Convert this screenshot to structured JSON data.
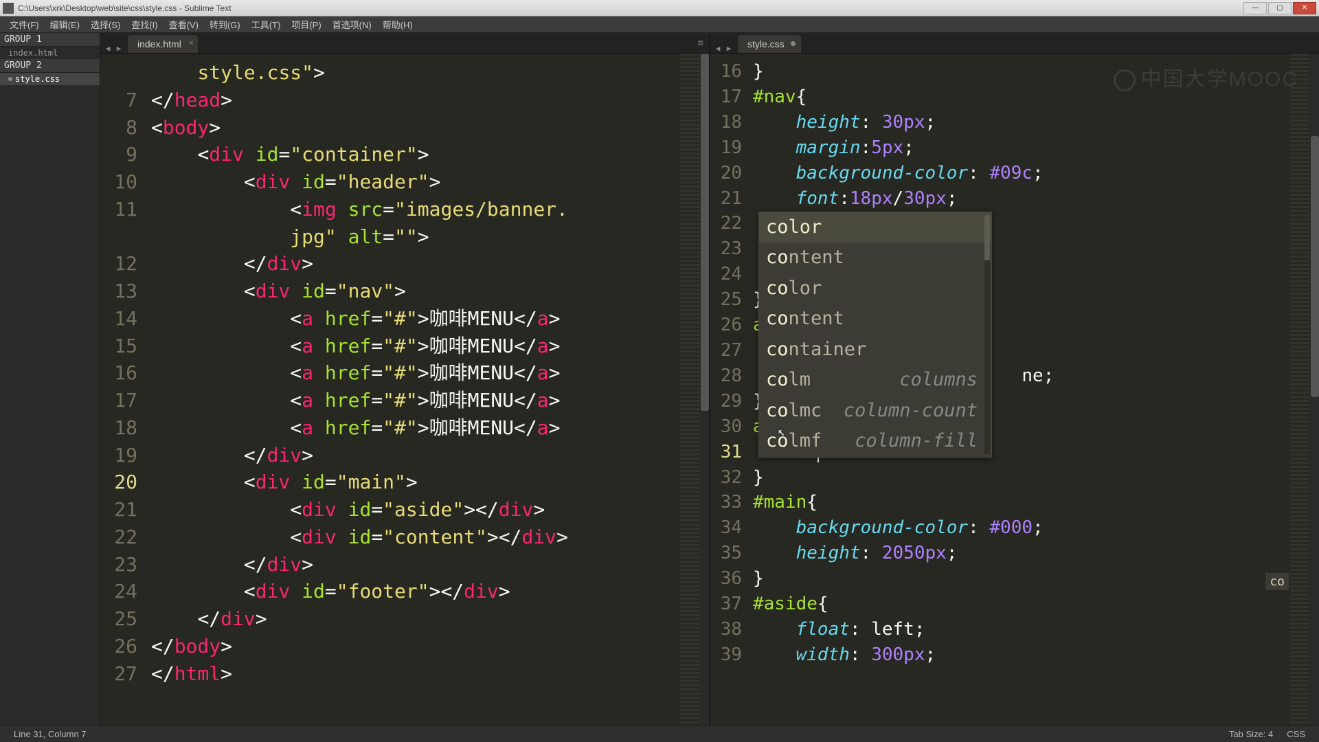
{
  "window": {
    "title": "C:\\Users\\xrk\\Desktop\\web\\site\\css\\style.css - Sublime Text"
  },
  "menus": [
    "文件(F)",
    "编辑(E)",
    "选择(S)",
    "查找(I)",
    "查看(V)",
    "转到(G)",
    "工具(T)",
    "项目(P)",
    "首选项(N)",
    "帮助(H)"
  ],
  "sidebar": {
    "group1": "GROUP 1",
    "group1_file": "index.html",
    "group2": "GROUP 2",
    "group2_file": "style.css"
  },
  "tabs": {
    "left": "index.html",
    "right": "style.css"
  },
  "left_lines": [
    {
      "n": 7,
      "html": "<span class='pun'>&lt;/</span><span class='tg'>head</span><span class='pun'>&gt;</span>",
      "indent": 0,
      "pretext": "style.css\"&gt;"
    },
    {
      "n": 8,
      "html": "<span class='pun'>&lt;</span><span class='tg'>body</span><span class='pun'>&gt;</span>"
    },
    {
      "n": 9,
      "html": "    <span class='pun'>&lt;</span><span class='tg'>div</span> <span class='an'>id</span><span class='pun'>=</span><span class='st'>\"container\"</span><span class='pun'>&gt;</span>"
    },
    {
      "n": 10,
      "html": "        <span class='pun'>&lt;</span><span class='tg'>div</span> <span class='an'>id</span><span class='pun'>=</span><span class='st'>\"header\"</span><span class='pun'>&gt;</span>"
    },
    {
      "n": 11,
      "html": "            <span class='pun'>&lt;</span><span class='tg'>img</span> <span class='an'>src</span><span class='pun'>=</span><span class='st'>\"images/banner.</span>"
    },
    {
      "n": "",
      "html": "            <span class='st'>jpg\"</span> <span class='an'>alt</span><span class='pun'>=</span><span class='st'>\"\"</span><span class='pun'>&gt;</span>"
    },
    {
      "n": 12,
      "html": "        <span class='pun'>&lt;/</span><span class='tg'>div</span><span class='pun'>&gt;</span>"
    },
    {
      "n": 13,
      "html": "        <span class='pun'>&lt;</span><span class='tg'>div</span> <span class='an'>id</span><span class='pun'>=</span><span class='st'>\"nav\"</span><span class='pun'>&gt;</span>"
    },
    {
      "n": 14,
      "html": "            <span class='pun'>&lt;</span><span class='tg'>a</span> <span class='an'>href</span><span class='pun'>=</span><span class='st'>\"#\"</span><span class='pun'>&gt;</span><span class='txt'>咖啡MENU</span><span class='pun'>&lt;/</span><span class='tg'>a</span><span class='pun'>&gt;</span>"
    },
    {
      "n": 15,
      "html": "            <span class='pun'>&lt;</span><span class='tg'>a</span> <span class='an'>href</span><span class='pun'>=</span><span class='st'>\"#\"</span><span class='pun'>&gt;</span><span class='txt'>咖啡MENU</span><span class='pun'>&lt;/</span><span class='tg'>a</span><span class='pun'>&gt;</span>"
    },
    {
      "n": 16,
      "html": "            <span class='pun'>&lt;</span><span class='tg'>a</span> <span class='an'>href</span><span class='pun'>=</span><span class='st'>\"#\"</span><span class='pun'>&gt;</span><span class='txt'>咖啡MENU</span><span class='pun'>&lt;/</span><span class='tg'>a</span><span class='pun'>&gt;</span>"
    },
    {
      "n": 17,
      "html": "            <span class='pun'>&lt;</span><span class='tg'>a</span> <span class='an'>href</span><span class='pun'>=</span><span class='st'>\"#\"</span><span class='pun'>&gt;</span><span class='txt'>咖啡MENU</span><span class='pun'>&lt;/</span><span class='tg'>a</span><span class='pun'>&gt;</span>"
    },
    {
      "n": 18,
      "html": "            <span class='pun'>&lt;</span><span class='tg'>a</span> <span class='an'>href</span><span class='pun'>=</span><span class='st'>\"#\"</span><span class='pun'>&gt;</span><span class='txt'>咖啡MENU</span><span class='pun'>&lt;/</span><span class='tg'>a</span><span class='pun'>&gt;</span>"
    },
    {
      "n": 19,
      "html": "        <span class='pun'>&lt;/</span><span class='tg'>div</span><span class='pun'>&gt;</span>"
    },
    {
      "n": 20,
      "hl": true,
      "html": "        <span class='pun'>&lt;</span><span class='tg'>div</span> <span class='an'>id</span><span class='pun'>=</span><span class='st'>\"main\"</span><span class='pun'>&gt;</span>"
    },
    {
      "n": 21,
      "html": "            <span class='pun'>&lt;</span><span class='tg'>div</span> <span class='an'>id</span><span class='pun'>=</span><span class='st'>\"aside\"</span><span class='pun'>&gt;&lt;/</span><span class='tg'>div</span><span class='pun'>&gt;</span>"
    },
    {
      "n": 22,
      "html": "            <span class='pun'>&lt;</span><span class='tg'>div</span> <span class='an'>id</span><span class='pun'>=</span><span class='st'>\"content\"</span><span class='pun'>&gt;&lt;/</span><span class='tg'>div</span><span class='pun'>&gt;</span>"
    },
    {
      "n": 23,
      "html": "        <span class='pun'>&lt;/</span><span class='tg'>div</span><span class='pun'>&gt;</span>"
    },
    {
      "n": 24,
      "html": "        <span class='pun'>&lt;</span><span class='tg'>div</span> <span class='an'>id</span><span class='pun'>=</span><span class='st'>\"footer\"</span><span class='pun'>&gt;&lt;/</span><span class='tg'>div</span><span class='pun'>&gt;</span>"
    },
    {
      "n": 25,
      "html": "    <span class='pun'>&lt;/</span><span class='tg'>div</span><span class='pun'>&gt;</span>"
    },
    {
      "n": 26,
      "html": "<span class='pun'>&lt;/</span><span class='tg'>body</span><span class='pun'>&gt;</span>"
    },
    {
      "n": 27,
      "html": "<span class='pun'>&lt;/</span><span class='tg'>html</span><span class='pun'>&gt;</span>"
    }
  ],
  "right_lines": [
    {
      "n": 16,
      "html": "<span class='pun'>}</span>"
    },
    {
      "n": 17,
      "html": "<span class='sel'>#nav</span><span class='pun'>{</span>"
    },
    {
      "n": 18,
      "html": "    <span class='prop'>height</span><span class='pun'>:</span> <span class='num'>30px</span><span class='pun'>;</span>"
    },
    {
      "n": 19,
      "html": "    <span class='prop'>margin</span><span class='pun'>:</span><span class='num'>5px</span><span class='pun'>;</span>"
    },
    {
      "n": 20,
      "html": "    <span class='prop'>background-color</span><span class='pun'>:</span> <span class='num'>#09c</span><span class='pun'>;</span>"
    },
    {
      "n": 21,
      "html": "    <span class='prop'>font</span><span class='pun'>:</span><span class='num'>18px</span><span class='pun'>/</span><span class='num'>30px</span><span class='pun'>;</span>"
    },
    {
      "n": 22,
      "html": "    "
    },
    {
      "n": 23,
      "html": "                    <span class='pun'>;</span>"
    },
    {
      "n": 24,
      "html": "                   <span class='pun'>;</span>"
    },
    {
      "n": 25,
      "html": "<span class='pun'>}</span>"
    },
    {
      "n": 26,
      "html": "<span class='sel'>a</span><span class='pun'>:</span><span class='sel'>li</span>"
    },
    {
      "n": 27,
      "html": "    "
    },
    {
      "n": 28,
      "html": "                         <span class='txt'>ne</span><span class='pun'>;</span>"
    },
    {
      "n": 29,
      "html": "<span class='pun'>}</span>"
    },
    {
      "n": 30,
      "html": "<span class='sel'>a</span><span class='pun'>:</span><span class='sel'>vi</span>"
    },
    {
      "n": 31,
      "hl": true,
      "html": "    <span class='txt'>co</span><span class='cursor'></span>"
    },
    {
      "n": 32,
      "html": "<span class='pun'>}</span>"
    },
    {
      "n": 33,
      "html": "<span class='sel'>#main</span><span class='pun'>{</span>"
    },
    {
      "n": 34,
      "html": "    <span class='prop'>background-color</span><span class='pun'>:</span> <span class='num'>#000</span><span class='pun'>;</span>"
    },
    {
      "n": 35,
      "html": "    <span class='prop'>height</span><span class='pun'>:</span> <span class='num'>2050px</span><span class='pun'>;</span>"
    },
    {
      "n": 36,
      "html": "<span class='pun'>}</span>"
    },
    {
      "n": 37,
      "html": "<span class='sel'>#aside</span><span class='pun'>{</span>"
    },
    {
      "n": 38,
      "html": "    <span class='prop'>float</span><span class='pun'>:</span> <span class='txt'>left</span><span class='pun'>;</span>"
    },
    {
      "n": 39,
      "html": "    <span class='prop'>width</span><span class='pun'>:</span> <span class='num'>300px</span><span class='pun'>;</span>"
    }
  ],
  "autocomplete": [
    {
      "label": "color",
      "match": "co",
      "sel": true
    },
    {
      "label": "content",
      "match": "co"
    },
    {
      "label": "color",
      "match": "co"
    },
    {
      "label": "content",
      "match": "co"
    },
    {
      "label": "container",
      "match": "co"
    },
    {
      "label": "colm",
      "match": "co",
      "meta": "columns"
    },
    {
      "label": "colmc",
      "match": "co",
      "meta": "column-count"
    },
    {
      "label": "colmf",
      "match": "co",
      "meta": "column-fill"
    }
  ],
  "status": {
    "left": "Line 31, Column 7",
    "tabsize": "Tab Size: 4",
    "syntax": "CSS"
  },
  "watermark": "中国大学MOOC",
  "minimap_hint": "co"
}
